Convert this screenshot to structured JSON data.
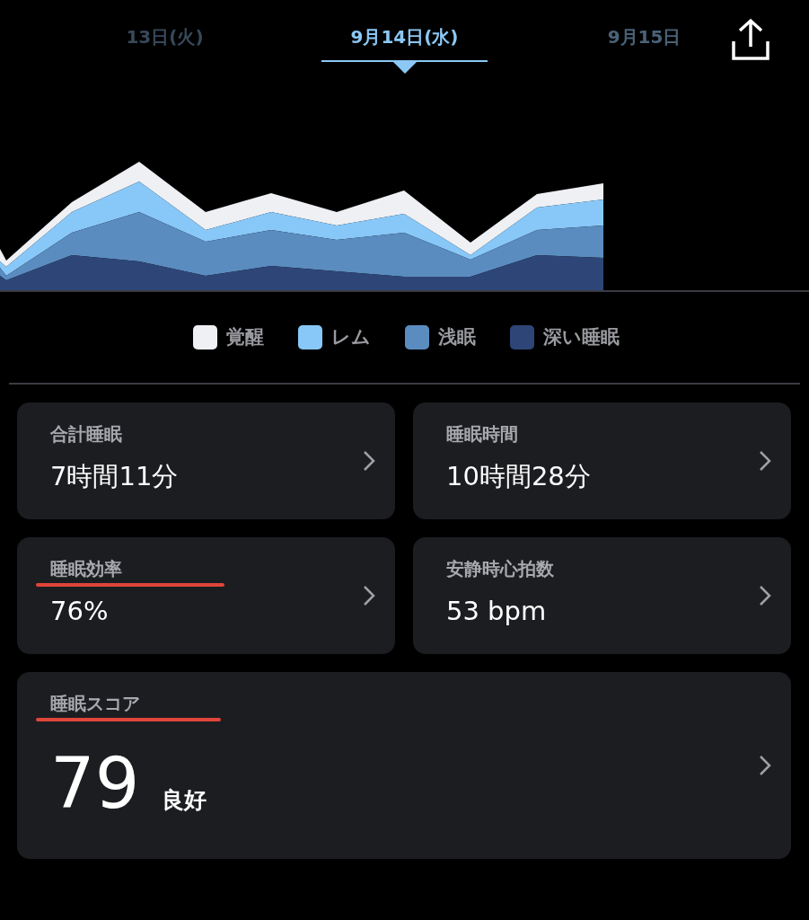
{
  "date_tabs": [
    {
      "label": "13日(火)",
      "selected": false
    },
    {
      "label": "9月14日(水)",
      "selected": true
    },
    {
      "label": "9月15日",
      "selected": false
    }
  ],
  "legend": [
    {
      "label": "覚醒",
      "color": "#eef0f3"
    },
    {
      "label": "レム",
      "color": "#88c8f8"
    },
    {
      "label": "浅眠",
      "color": "#5b8cc0"
    },
    {
      "label": "深い睡眠",
      "color": "#2e4677"
    }
  ],
  "stats": [
    {
      "label": "合計睡眠",
      "value": "7時間11分",
      "underlined": false
    },
    {
      "label": "睡眠時間",
      "value": "10時間28分",
      "underlined": false
    },
    {
      "label": "睡眠効率",
      "value": "76%",
      "underlined": true
    },
    {
      "label": "安静時心拍数",
      "value": "53 bpm",
      "underlined": false
    }
  ],
  "score": {
    "label": "睡眠スコア",
    "value": "79",
    "rating": "良好",
    "underlined": true
  }
}
